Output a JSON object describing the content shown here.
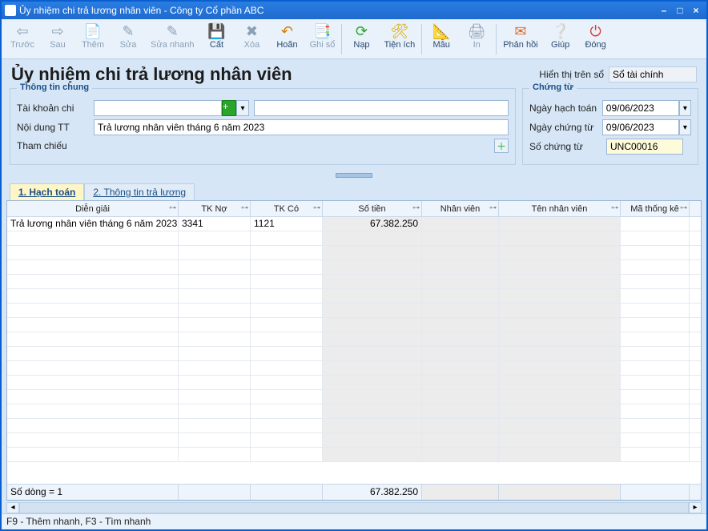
{
  "window": {
    "title": "Ủy nhiệm chi trả lương nhân viên - Công ty Cổ phần ABC",
    "buttons": {
      "min": "–",
      "max": "□",
      "close": "×"
    }
  },
  "toolbar": {
    "truoc": "Trước",
    "sau": "Sau",
    "them": "Thêm",
    "sua": "Sửa",
    "suanhanh": "Sửa nhanh",
    "cat": "Cất",
    "xoa": "Xoa",
    "xoa_lbl": "Xóa",
    "hoan": "Hoãn",
    "ghiso": "Ghi sổ",
    "nap": "Nạp",
    "tienich": "Tiện ích",
    "mau": "Mẫu",
    "in": "In",
    "phanhoi": "Phản hồi",
    "giup": "Giúp",
    "dong": "Đóng"
  },
  "header": {
    "title": "Ủy nhiệm chi trả lương nhân viên",
    "display_on_label": "Hiển thị trên sổ",
    "display_on_value": "Sổ tài chính"
  },
  "group_general": {
    "legend": "Thông tin chung",
    "account_label": "Tài khoản chi",
    "account_value": "",
    "account_desc": "",
    "content_label": "Nội dung TT",
    "content_value": "Trả lương nhân viên tháng 6 năm 2023",
    "ref_label": "Tham chiếu"
  },
  "group_voucher": {
    "legend": "Chứng từ",
    "acc_date_label": "Ngày hạch toán",
    "acc_date_value": "09/06/2023",
    "voucher_date_label": "Ngày chứng từ",
    "voucher_date_value": "09/06/2023",
    "voucher_no_label": "Số chứng từ",
    "voucher_no_value": "UNC00016"
  },
  "tabs": {
    "hachtoan": "1. Hạch toán",
    "ttluong": "2. Thông tin trả lương"
  },
  "grid": {
    "columns": {
      "dien_giai": "Diễn giải",
      "tk_no": "TK Nợ",
      "tk_co": "TK Có",
      "so_tien": "Số tiền",
      "nhan_vien": "Nhân viên",
      "ten_nv": "Tên nhân viên",
      "ma_tk": "Mã thống kê"
    },
    "rows": [
      {
        "dien_giai": "Trả lương nhân viên tháng 6 năm 2023",
        "tk_no": "3341",
        "tk_co": "1121",
        "so_tien": "67.382.250",
        "nhan_vien": "",
        "ten_nv": "",
        "ma_tk": ""
      }
    ],
    "footer": {
      "row_count": "Số dòng = 1",
      "sum_so_tien": "67.382.250"
    }
  },
  "statusbar": "F9 - Thêm nhanh, F3 - Tìm nhanh"
}
